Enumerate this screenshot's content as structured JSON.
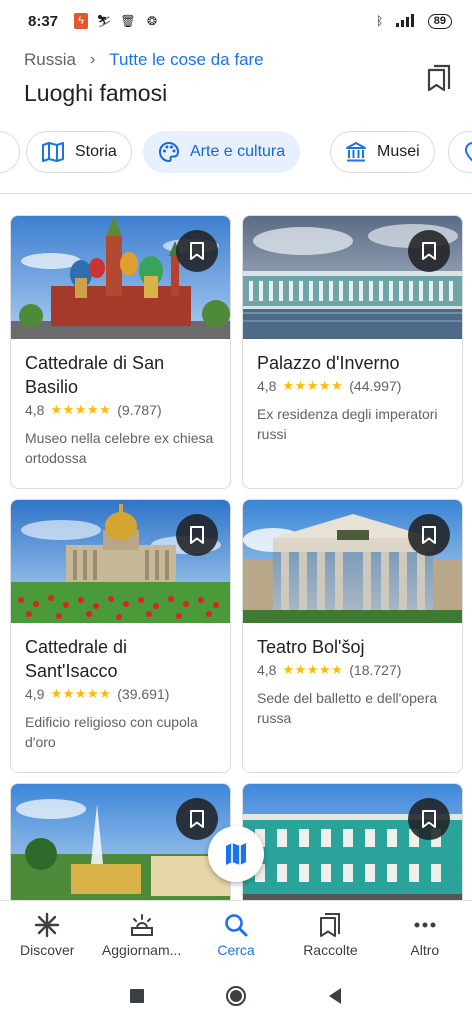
{
  "status_bar": {
    "time": "8:37",
    "battery": "89"
  },
  "header": {
    "breadcrumb_root": "Russia",
    "breadcrumb_current": "Tutte le cose da fare",
    "title": "Luoghi famosi"
  },
  "chips": [
    {
      "label": "Storia",
      "icon": "map-book-icon"
    },
    {
      "label": "Arte e cultura",
      "icon": "palette-icon",
      "active": true
    },
    {
      "label": "Musei",
      "icon": "museum-icon"
    }
  ],
  "cards": [
    {
      "title": "Cattedrale di San Basilio",
      "rating": "4,8",
      "stars": "★★★★★",
      "reviews": "(9.787)",
      "description": "Museo nella celebre ex chiesa ortodossa"
    },
    {
      "title": "Palazzo d'Inverno",
      "rating": "4,8",
      "stars": "★★★★★",
      "reviews": "(44.997)",
      "description": "Ex residenza degli imperatori russi"
    },
    {
      "title": "Cattedrale di Sant'Isacco",
      "rating": "4,9",
      "stars": "★★★★★",
      "reviews": "(39.691)",
      "description": "Edificio religioso con cupola d'oro"
    },
    {
      "title": "Teatro Bol'šoj",
      "rating": "4,8",
      "stars": "★★★★★",
      "reviews": "(18.727)",
      "description": "Sede del balletto e dell'opera russa"
    }
  ],
  "bottom_nav": [
    {
      "label": "Discover",
      "icon": "asterisk-icon"
    },
    {
      "label": "Aggiornam...",
      "icon": "sunrise-icon"
    },
    {
      "label": "Cerca",
      "icon": "search-icon",
      "active": true
    },
    {
      "label": "Raccolte",
      "icon": "bookmarks-icon"
    },
    {
      "label": "Altro",
      "icon": "more-icon"
    }
  ],
  "colors": {
    "accent": "#1a73e8",
    "active_chip_bg": "#e8f0fe",
    "star": "#fbbc04"
  }
}
